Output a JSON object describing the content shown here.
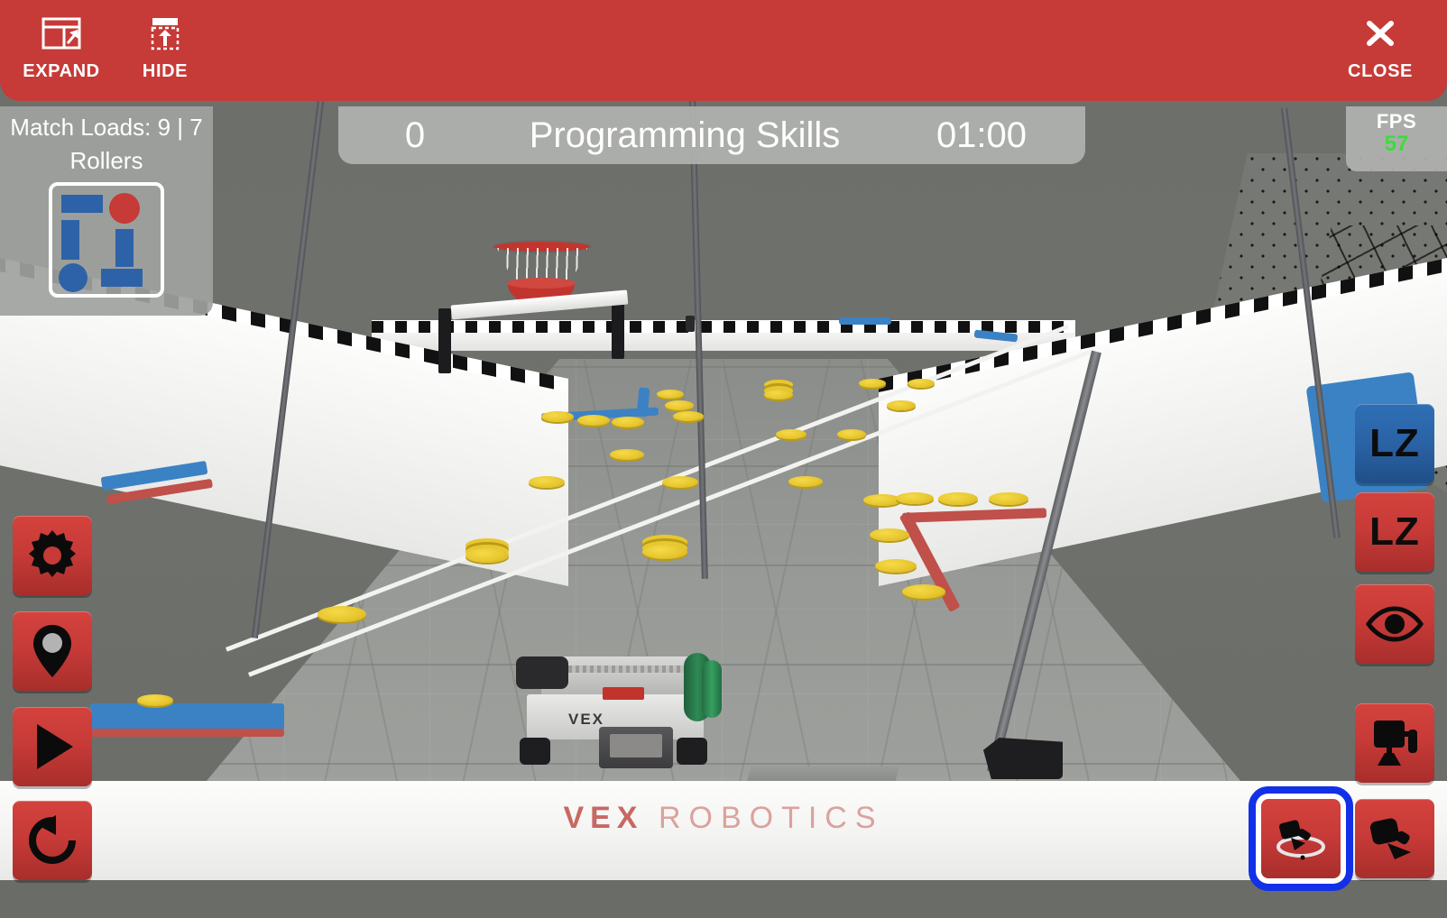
{
  "toolbar": {
    "expand_label": "EXPAND",
    "hide_label": "HIDE",
    "close_label": "CLOSE",
    "background_color": "#C63A37"
  },
  "scoreboard": {
    "score": "0",
    "match_title": "Programming Skills",
    "timer": "01:00"
  },
  "fps": {
    "label": "FPS",
    "value": "57",
    "value_color": "#3BDD3B"
  },
  "match_loads": {
    "text": "Match Loads: 9 | 7",
    "rollers_label": "Rollers",
    "diagram": {
      "blue_color": "#2D62A8",
      "red_color": "#C63A37"
    }
  },
  "left_toolbar": {
    "buttons": [
      {
        "name": "settings",
        "icon": "gear-icon"
      },
      {
        "name": "waypoint",
        "icon": "map-pin-icon"
      },
      {
        "name": "play",
        "icon": "play-icon"
      },
      {
        "name": "reset",
        "icon": "reset-icon"
      }
    ]
  },
  "right_toolbar": {
    "buttons": [
      {
        "name": "loading-zone-blue",
        "label": "LZ",
        "color": "#2A63A6"
      },
      {
        "name": "loading-zone-red",
        "label": "LZ",
        "color": "#C63A37"
      },
      {
        "name": "visibility",
        "icon": "eye-icon",
        "color": "#C63A37"
      },
      {
        "name": "camera-front",
        "icon": "camera-front-icon",
        "color": "#C63A37"
      },
      {
        "name": "camera-orbit",
        "icon": "camera-orbit-icon",
        "color": "#C63A37",
        "selected": true
      },
      {
        "name": "camera-chase",
        "icon": "camera-chase-icon",
        "color": "#C63A37"
      }
    ],
    "selection_color": "#1230E8"
  },
  "field": {
    "brand_primary": "VEX",
    "brand_secondary": "ROBOTICS",
    "brand_color": "#C0504A",
    "robot_label": "VEX",
    "game_pieces": {
      "disc_color": "#E8C72F",
      "count_visible": 31
    },
    "barriers": {
      "blue_color": "#3B82C4",
      "red_color": "#C0504A"
    },
    "goal_color": "#C2352F"
  }
}
